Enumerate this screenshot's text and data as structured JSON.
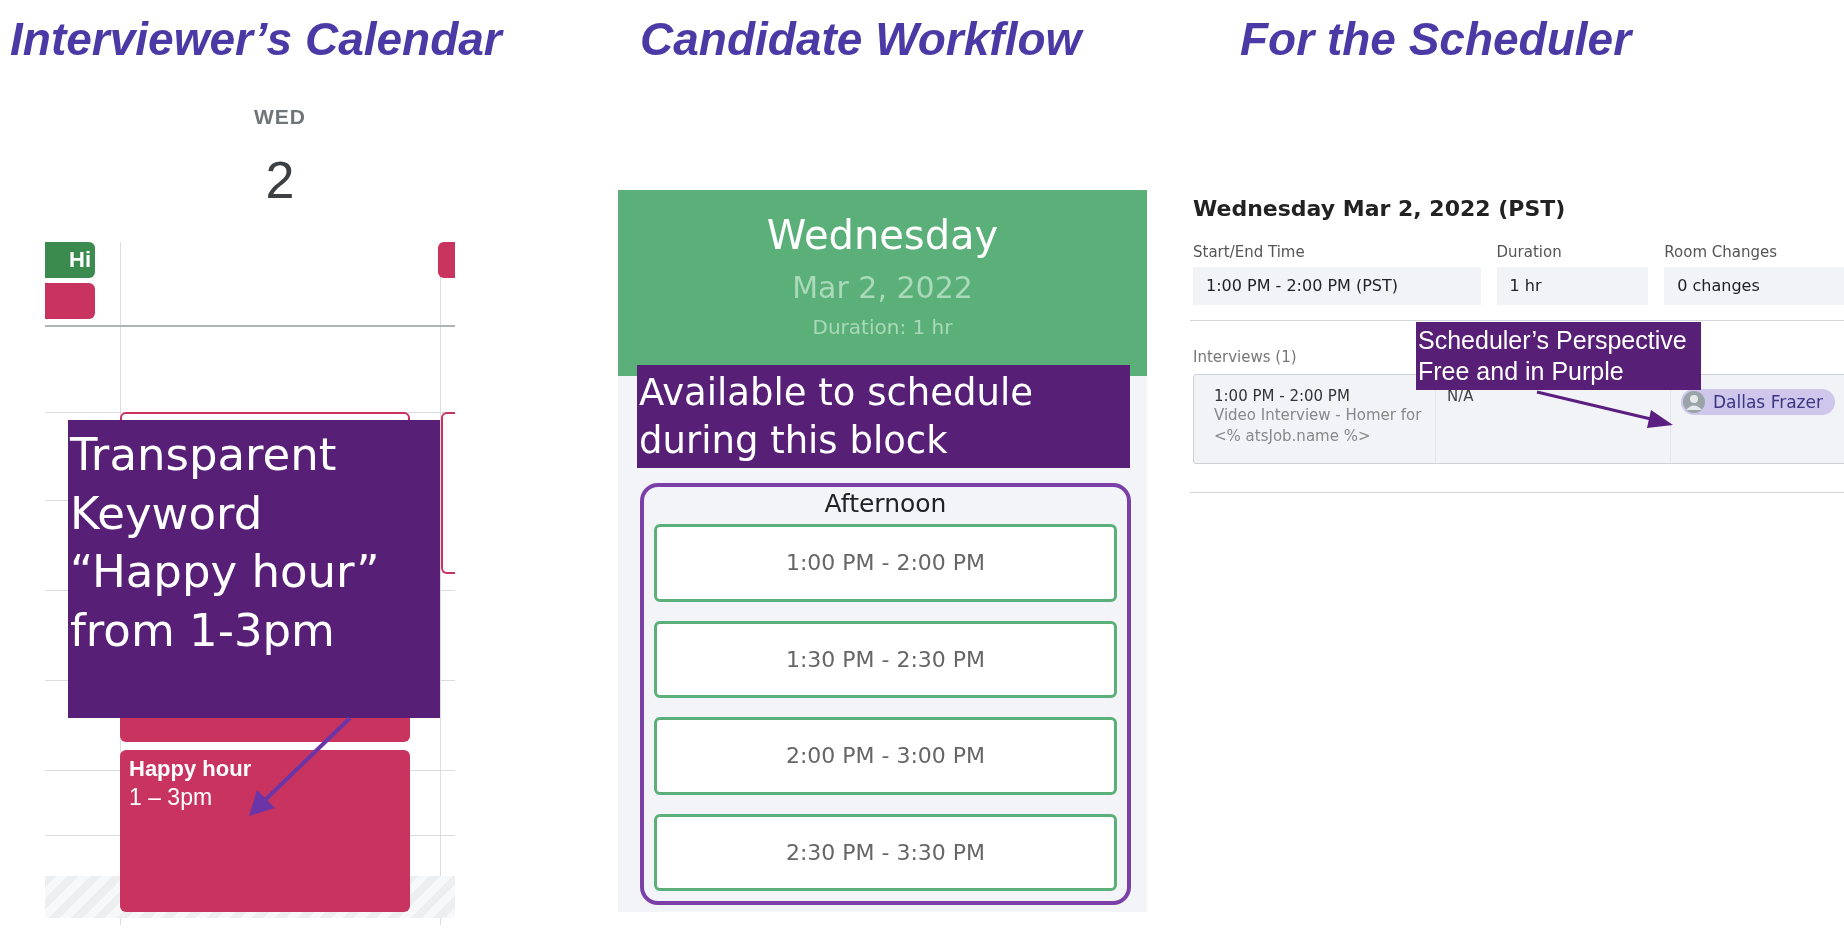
{
  "sections": [
    {
      "title": "Interviewer’s Calendar"
    },
    {
      "title": "Candidate Workflow"
    },
    {
      "title": "For the Scheduler"
    }
  ],
  "calendar": {
    "weekday": "WED",
    "day": "2",
    "allday_events": [
      {
        "label": "Hi",
        "color": "#3b8a4e"
      },
      {
        "color": "#c8345f"
      }
    ],
    "event": {
      "title": "Happy hour",
      "time": "1 – 3pm"
    },
    "note": [
      "Transparent",
      "Keyword",
      "“Happy hour”",
      "from 1-3pm"
    ]
  },
  "workflow": {
    "day": "Wednesday",
    "date": "Mar 2, 2022",
    "duration": "Duration: 1 hr",
    "note": [
      "Available to schedule",
      "during this block"
    ],
    "period": "Afternoon",
    "slots": [
      "1:00 PM - 2:00 PM",
      "1:30 PM - 2:30 PM",
      "2:00 PM - 3:00 PM",
      "2:30 PM - 3:30 PM"
    ]
  },
  "scheduler": {
    "heading": "Wednesday Mar 2, 2022 (PST)",
    "fields": [
      {
        "label": "Start/End Time",
        "value": "1:00 PM - 2:00 PM (PST)"
      },
      {
        "label": "Duration",
        "value": "1 hr"
      },
      {
        "label": "Room Changes",
        "value": "0 changes"
      }
    ],
    "interviews_label": "Interviews (1)",
    "interview": {
      "time": "1:00 PM - 2:00 PM",
      "description": "Video Interview - Homer for <% atsJob.name %>",
      "column_2": "N/A",
      "interviewer": "Dallas Frazer"
    },
    "note": [
      "Scheduler’s Perspective",
      "Free and in Purple"
    ]
  }
}
